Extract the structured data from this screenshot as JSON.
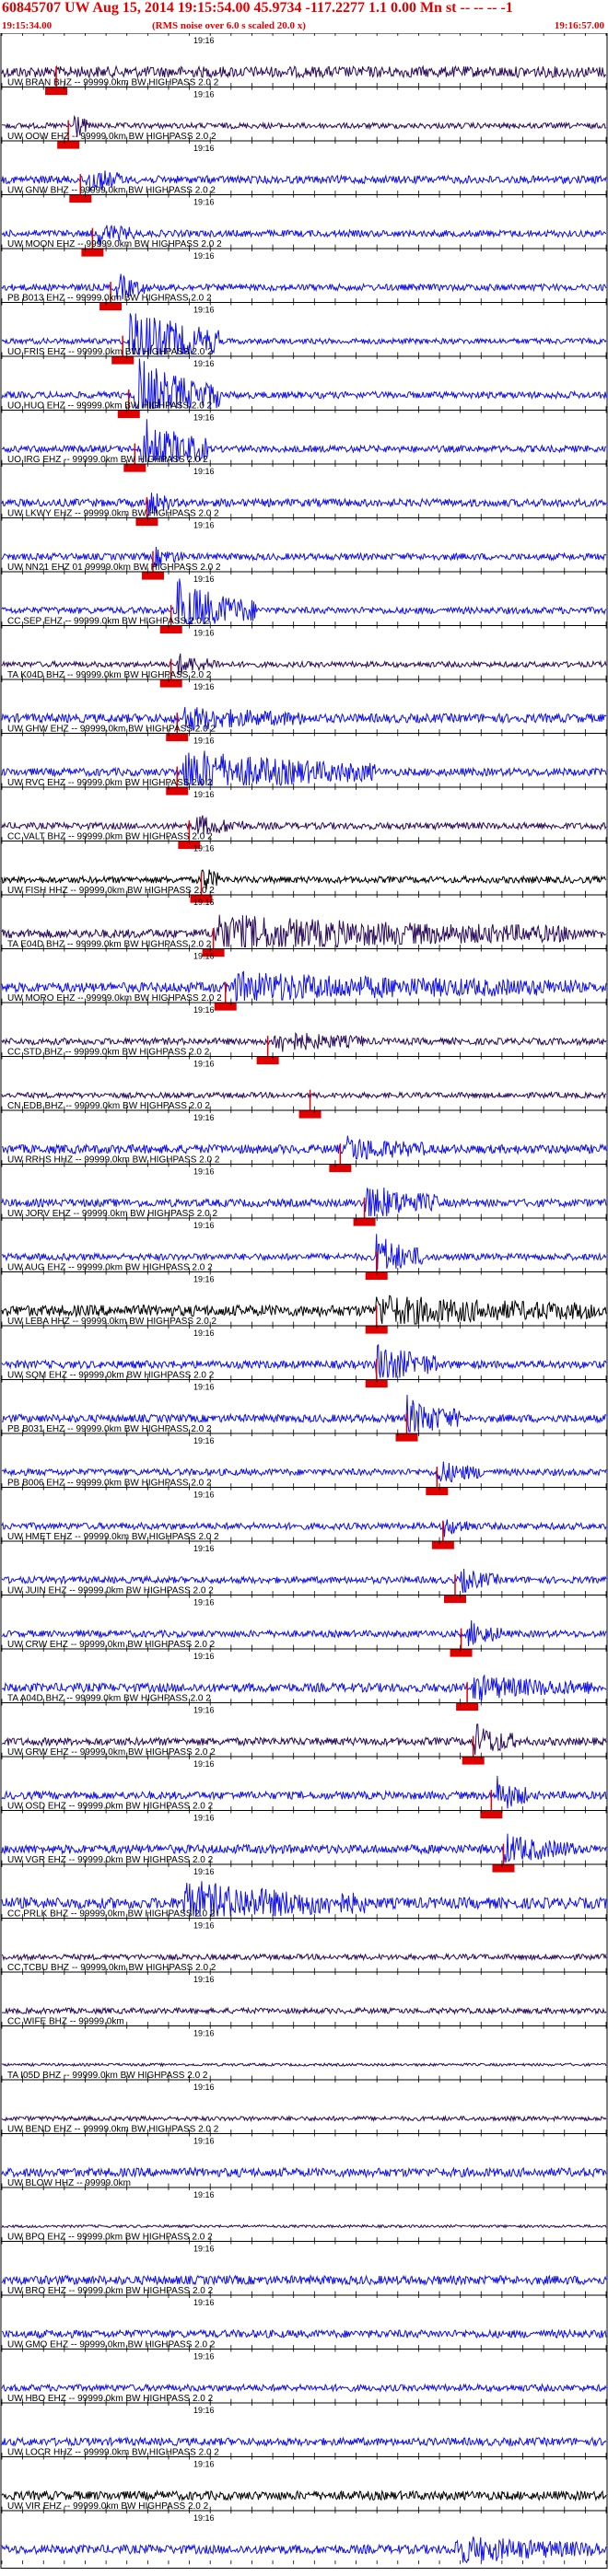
{
  "header": {
    "title": "60845707 UW Aug 15, 2014 19:15:54.00   45.9734 -117.2277  1.1 0.00 Mn st -- -- --  -1",
    "start_time": "19:15:34.00",
    "note": "(RMS noise over 6.0 s scaled 20.0 x)",
    "end_time": "19:16:57.00"
  },
  "tick_label": "19:16",
  "colors": {
    "blue": "#1010e8",
    "dark": "#2a0a5a",
    "black": "#000000",
    "pick": "#e00000"
  },
  "traces": [
    {
      "label": "",
      "color": "dark",
      "amp": 0.5,
      "pick": 0.09,
      "burst": null
    },
    {
      "label": "UW BRAN BHZ -- 99999.0km BW  HIGHPASS  2.0  2",
      "color": "dark",
      "amp": 0.25,
      "pick": 0.11,
      "burst": [
        0.12,
        0.14,
        1.6
      ]
    },
    {
      "label": "UW OOW EHZ -- 99999.0km BW  HIGHPASS  2.0  2",
      "color": "blue",
      "amp": 0.35,
      "pick": 0.13,
      "burst": [
        0.14,
        0.2,
        1.2
      ]
    },
    {
      "label": "UW GNW BHZ -- 99999.0km BW  HIGHPASS  2.0  2",
      "color": "blue",
      "amp": 0.3,
      "pick": 0.15,
      "burst": [
        0.16,
        0.22,
        1.0
      ]
    },
    {
      "label": "UW MOON EHZ -- 99999.0km BW  HIGHPASS  2.0  2",
      "color": "blue",
      "amp": 0.3,
      "pick": 0.18,
      "burst": [
        0.19,
        0.24,
        1.2
      ]
    },
    {
      "label": "PB B013 EHZ -- 99999.0km BW  HIGHPASS  2.0  2",
      "color": "blue",
      "amp": 0.25,
      "pick": 0.2,
      "burst": [
        0.21,
        0.36,
        3.5
      ]
    },
    {
      "label": "UO FRIS EHZ -- 99999.0km BW  HIGHPASS  2.0  2",
      "color": "blue",
      "amp": 0.3,
      "pick": 0.21,
      "burst": [
        0.22,
        0.36,
        3.5
      ]
    },
    {
      "label": "UO HUO EHZ -- 99999.0km BW  HIGHPASS  2.0  2",
      "color": "blue",
      "amp": 0.3,
      "pick": 0.22,
      "burst": [
        0.23,
        0.34,
        3.0
      ]
    },
    {
      "label": "UO IRG EHZ -- 99999.0km BW  HIGHPASS  2.0  2",
      "color": "blue",
      "amp": 0.35,
      "pick": 0.24,
      "burst": [
        0.24,
        0.28,
        1.2
      ]
    },
    {
      "label": "UW LKWY EHZ -- 99999.0km BW  HIGHPASS  2.0  2",
      "color": "blue",
      "amp": 0.3,
      "pick": 0.25,
      "burst": [
        0.25,
        0.3,
        0.8
      ]
    },
    {
      "label": "UW NN21 EHZ 01 99999.0km BW  HIGHPASS  2.0  2",
      "color": "blue",
      "amp": 0.3,
      "pick": 0.28,
      "burst": [
        0.29,
        0.42,
        2.8
      ]
    },
    {
      "label": "CC SEP EHZ -- 99999.0km BW  HIGHPASS  2.0  2",
      "color": "dark",
      "amp": 0.25,
      "pick": 0.28,
      "burst": [
        0.29,
        0.36,
        0.9
      ]
    },
    {
      "label": "TA K04D BHZ -- 99999.0km BW  HIGHPASS  2.0  2",
      "color": "blue",
      "amp": 0.4,
      "pick": 0.29,
      "burst": [
        0.3,
        0.5,
        0.9
      ]
    },
    {
      "label": "UW GHW EHZ -- 99999.0km BW  HIGHPASS  2.0  2",
      "color": "blue",
      "amp": 0.35,
      "pick": 0.29,
      "burst": [
        0.3,
        0.62,
        2.0
      ]
    },
    {
      "label": "UW RVC EHZ -- 99999.0km BW  HIGHPASS  2.0  2",
      "color": "dark",
      "amp": 0.3,
      "pick": 0.31,
      "burst": [
        0.32,
        0.4,
        0.9
      ]
    },
    {
      "label": "CC VALT BHZ -- 99999.0km BW  HIGHPASS  2.0  2",
      "color": "black",
      "amp": 0.3,
      "pick": 0.33,
      "burst": [
        0.33,
        0.36,
        1.4
      ]
    },
    {
      "label": "UW FISH HHZ -- 99999.0km BW  HIGHPASS  2.0  2",
      "color": "dark",
      "amp": 0.4,
      "pick": 0.35,
      "burst": [
        0.35,
        0.95,
        1.5
      ]
    },
    {
      "label": "TA E04D BHZ -- 99999.0km BW  HIGHPASS  2.0  2",
      "color": "blue",
      "amp": 0.45,
      "pick": 0.37,
      "burst": [
        0.38,
        0.95,
        1.1
      ]
    },
    {
      "label": "UW MORO EHZ -- 99999.0km BW  HIGHPASS  2.0  2",
      "color": "dark",
      "amp": 0.3,
      "pick": 0.44,
      "burst": [
        0.45,
        0.6,
        0.9
      ]
    },
    {
      "label": "CC STD BHZ -- 99999.0km BW  HIGHPASS  2.0  2",
      "color": "dark",
      "amp": 0.25,
      "pick": 0.51,
      "burst": null
    },
    {
      "label": "CN EDB BHZ -- 99999.0km BW  HIGHPASS  2.0  2",
      "color": "blue",
      "amp": 0.4,
      "pick": 0.56,
      "burst": [
        0.57,
        0.7,
        1.0
      ]
    },
    {
      "label": "UW RRHS HHZ -- 99999.0km BW  HIGHPASS  2.0  2",
      "color": "blue",
      "amp": 0.35,
      "pick": 0.6,
      "burst": [
        0.6,
        0.72,
        1.8
      ]
    },
    {
      "label": "UW JORV EHZ -- 99999.0km BW  HIGHPASS  2.0  2",
      "color": "blue",
      "amp": 0.3,
      "pick": 0.62,
      "burst": [
        0.62,
        0.7,
        2.0
      ]
    },
    {
      "label": "UW AUG EHZ -- 99999.0km BW  HIGHPASS  2.0  2",
      "color": "black",
      "amp": 0.5,
      "pick": 0.62,
      "burst": [
        0.62,
        0.98,
        1.1
      ]
    },
    {
      "label": "UW LEBA HHZ -- 99999.0km BW  HIGHPASS  2.0  2",
      "color": "blue",
      "amp": 0.35,
      "pick": 0.62,
      "burst": [
        0.62,
        0.72,
        2.0
      ]
    },
    {
      "label": "UW SQM EHZ -- 99999.0km BW  HIGHPASS  2.0  2",
      "color": "blue",
      "amp": 0.35,
      "pick": 0.67,
      "burst": [
        0.67,
        0.76,
        1.9
      ]
    },
    {
      "label": "PB B031 EHZ -- 99999.0km BW  HIGHPASS  2.0  2",
      "color": "blue",
      "amp": 0.3,
      "pick": 0.72,
      "burst": [
        0.72,
        0.8,
        1.0
      ]
    },
    {
      "label": "PB B006 EHZ -- 99999.0km BW  HIGHPASS  2.0  2",
      "color": "blue",
      "amp": 0.3,
      "pick": 0.73,
      "burst": [
        0.73,
        0.78,
        0.8
      ]
    },
    {
      "label": "UW HMET EHZ -- 99999.0km BW  HIGHPASS  2.0  2",
      "color": "blue",
      "amp": 0.3,
      "pick": 0.75,
      "burst": [
        0.76,
        0.82,
        1.0
      ]
    },
    {
      "label": "UW JUIN EHZ -- 99999.0km BW  HIGHPASS  2.0  2",
      "color": "blue",
      "amp": 0.3,
      "pick": 0.76,
      "burst": [
        0.77,
        0.83,
        1.2
      ]
    },
    {
      "label": "UW CRW EHZ -- 99999.0km BW  HIGHPASS  2.0  2",
      "color": "blue",
      "amp": 0.4,
      "pick": 0.77,
      "burst": [
        0.78,
        0.98,
        0.9
      ]
    },
    {
      "label": "TA A04D BHZ -- 99999.0km BW  HIGHPASS  2.0  2",
      "color": "dark",
      "amp": 0.35,
      "pick": 0.78,
      "burst": [
        0.78,
        0.85,
        1.6
      ]
    },
    {
      "label": "UW GRW EHZ -- 99999.0km BW  HIGHPASS  2.0  2",
      "color": "blue",
      "amp": 0.35,
      "pick": 0.81,
      "burst": [
        0.82,
        0.87,
        1.6
      ]
    },
    {
      "label": "UW OSD EHZ -- 99999.0km BW  HIGHPASS  2.0  2",
      "color": "blue",
      "amp": 0.4,
      "pick": 0.83,
      "burst": [
        0.83,
        0.95,
        1.2
      ]
    },
    {
      "label": "UW VGR EHZ -- 99999.0km BW  HIGHPASS  2.0  2",
      "color": "blue",
      "amp": 0.5,
      "pick": null,
      "burst": [
        0.3,
        0.6,
        1.8
      ]
    },
    {
      "label": "CC PRLK BHZ -- 99999.0km BW  HIGHPASS  2.0  2",
      "color": "dark",
      "amp": 0.25,
      "pick": null,
      "burst": null
    },
    {
      "label": "CC TCBU BHZ -- 99999.0km BW  HIGHPASS  2.0  2",
      "color": "dark",
      "amp": 0.25,
      "pick": null,
      "burst": null
    },
    {
      "label": "CC WIFE BHZ -- 99999.0km",
      "color": "dark",
      "amp": 0.12,
      "pick": null,
      "burst": null
    },
    {
      "label": "TA I05D BHZ -- 99999.0km BW  HIGHPASS  2.0  2",
      "color": "dark",
      "amp": 0.2,
      "pick": null,
      "burst": null
    },
    {
      "label": "UW BEND EHZ -- 99999.0km BW  HIGHPASS  2.0  2",
      "color": "blue",
      "amp": 0.4,
      "pick": null,
      "burst": null
    },
    {
      "label": "UW BLOW HHZ -- 99999.0km",
      "color": "dark",
      "amp": 0.12,
      "pick": null,
      "burst": null
    },
    {
      "label": "UW BPO EHZ -- 99999.0km BW  HIGHPASS  2.0  2",
      "color": "blue",
      "amp": 0.4,
      "pick": null,
      "burst": null
    },
    {
      "label": "UW BRO EHZ -- 99999.0km BW  HIGHPASS  2.0  2",
      "color": "blue",
      "amp": 0.35,
      "pick": null,
      "burst": null
    },
    {
      "label": "UW GMO EHZ -- 99999.0km BW  HIGHPASS  2.0  2",
      "color": "blue",
      "amp": 0.3,
      "pick": null,
      "burst": null
    },
    {
      "label": "UW HBO EHZ -- 99999.0km BW  HIGHPASS  2.0  2",
      "color": "blue",
      "amp": 0.35,
      "pick": null,
      "burst": null
    },
    {
      "label": "UW LOCR HHZ -- 99999.0km BW  HIGHPASS  2.0  2",
      "color": "black",
      "amp": 0.4,
      "pick": null,
      "burst": null
    },
    {
      "label": "UW VIR EHZ -- 99999.0km BW  HIGHPASS  2.0  2",
      "color": "blue",
      "amp": 0.4,
      "pick": null,
      "burst": [
        0.75,
        0.99,
        1.1
      ]
    }
  ]
}
